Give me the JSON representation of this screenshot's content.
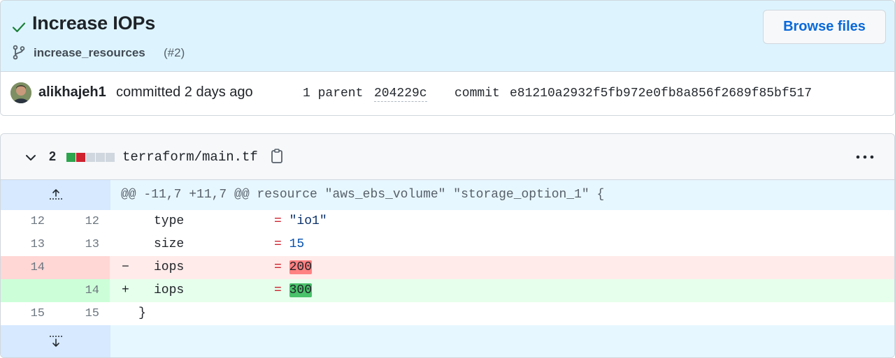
{
  "commit": {
    "title": "Increase IOPs",
    "branch": "increase_resources",
    "pr_ref": "(#2)",
    "browse_label": "Browse files",
    "author": "alikhajeh1",
    "committed_text": "committed 2 days ago",
    "parent_label": "1 parent",
    "parent_sha": "204229c",
    "commit_label": "commit",
    "commit_sha": "e81210a2932f5fb972e0fb8a856f2689f85bf517"
  },
  "file": {
    "change_count": "2",
    "diffstat": [
      "added",
      "removed",
      "neutral",
      "neutral",
      "neutral"
    ],
    "path": "terraform/main.tf",
    "hunk_header": "@@ -11,7 +11,7 @@ resource \"aws_ebs_volume\" \"storage_option_1\" {"
  },
  "diff": {
    "rows": [
      {
        "old": "12",
        "new": "12",
        "marker": "",
        "key": "type",
        "value": "\"io1\""
      },
      {
        "old": "13",
        "new": "13",
        "marker": "",
        "key": "size",
        "value": "15"
      },
      {
        "old": "14",
        "new": "",
        "marker": "−",
        "key": "iops",
        "value": "200"
      },
      {
        "old": "",
        "new": "14",
        "marker": "+",
        "key": "iops",
        "value": "300"
      },
      {
        "old": "15",
        "new": "15",
        "marker": "",
        "key": "}",
        "value": ""
      }
    ],
    "equals": "="
  },
  "colors": {
    "header_bg": "#ddf4ff",
    "link": "#0969da",
    "deletion_bg": "#ffebe9",
    "addition_bg": "#e6ffec",
    "deletion_gutter": "#ffd7d5",
    "addition_gutter": "#ccffd8"
  }
}
